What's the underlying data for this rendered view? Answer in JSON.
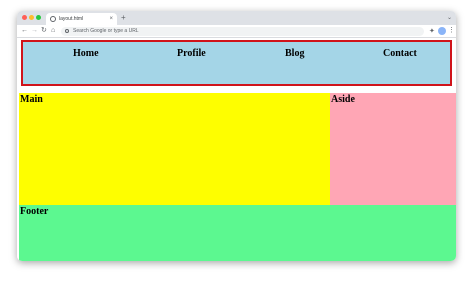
{
  "browser": {
    "tab_title": "layout.html",
    "tab_close": "×",
    "new_tab": "+",
    "omnibox_placeholder": "Search Google or type a URL",
    "icons": {
      "back": "back-arrow-icon",
      "forward": "forward-arrow-icon",
      "reload": "reload-icon",
      "home": "home-icon",
      "extensions": "puzzle-icon",
      "menu": "kebab-menu-icon"
    }
  },
  "page": {
    "nav": [
      "Home",
      "Profile",
      "Blog",
      "Contact"
    ],
    "main_label": "Main",
    "aside_label": "Aside",
    "footer_label": "Footer"
  },
  "colors": {
    "header_bg": "#a4d5e7",
    "header_border": "#d0131a",
    "main_bg": "#fefe00",
    "aside_bg": "#ffa6b5",
    "footer_bg": "#5cf890"
  }
}
